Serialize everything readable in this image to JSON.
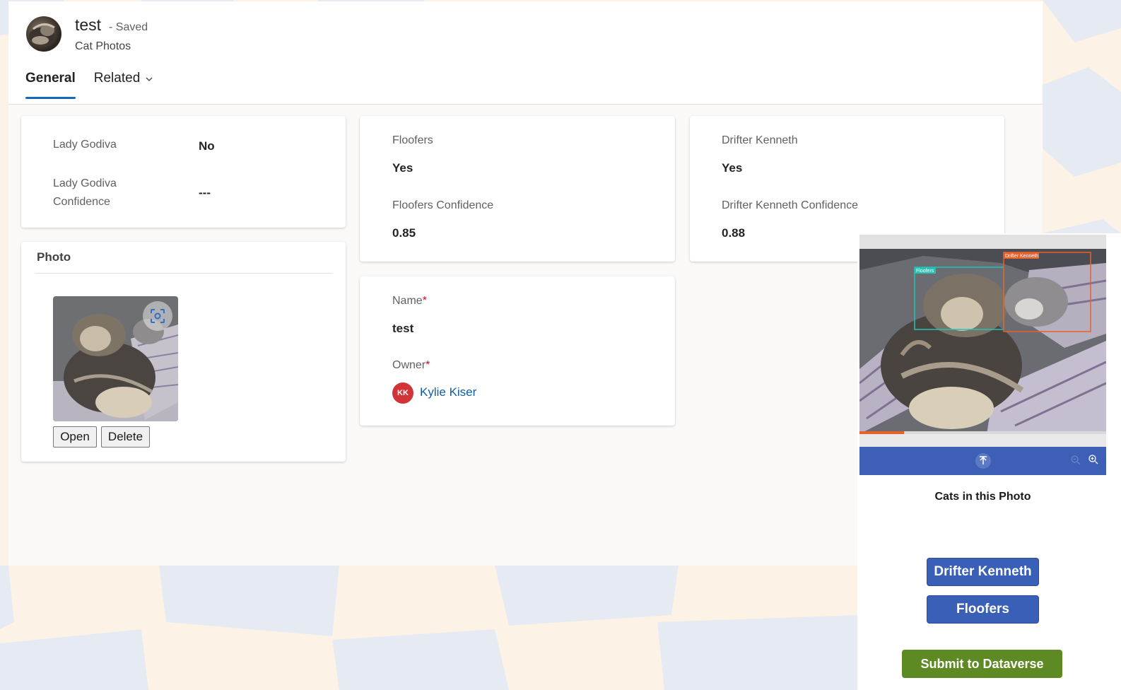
{
  "header": {
    "title": "test",
    "status": "- Saved",
    "entity": "Cat Photos",
    "avatar_icon": "cat-photo-avatar"
  },
  "tabs": [
    {
      "label": "General",
      "active": true
    },
    {
      "label": "Related",
      "active": false,
      "icon": "chevron-down-icon"
    }
  ],
  "cards": {
    "lady_godiva": {
      "label": "Lady Godiva",
      "value": "No",
      "confidence_label_line1": "Lady Godiva",
      "confidence_label_line2": "Confidence",
      "confidence_value": "---"
    },
    "floofers": {
      "label": "Floofers",
      "value": "Yes",
      "confidence_label": "Floofers Confidence",
      "confidence_value": "0.85"
    },
    "drifter_kenneth": {
      "label": "Drifter Kenneth",
      "value": "Yes",
      "confidence_label": "Drifter Kenneth Confidence",
      "confidence_value": "0.88"
    },
    "photo": {
      "title": "Photo",
      "open_label": "Open",
      "delete_label": "Delete",
      "scan_icon": "image-scan-icon"
    },
    "details": {
      "name_label": "Name",
      "name_value": "test",
      "owner_label": "Owner",
      "required_marker": "*",
      "owner_initials": "KK",
      "owner_name": "Kylie Kiser"
    }
  },
  "side_panel": {
    "detections": [
      {
        "label": "Floofers",
        "color": "#20c5b5"
      },
      {
        "label": "Drifter Kenneth",
        "color": "#e8602a"
      }
    ],
    "progress": 0.18,
    "toolbar_icons": [
      "upload-icon",
      "zoom-out-icon",
      "zoom-in-icon"
    ],
    "cats_title": "Cats in this Photo",
    "cat_buttons": [
      "Drifter Kenneth",
      "Floofers"
    ],
    "submit_label": "Submit to Dataverse"
  },
  "colors": {
    "accent_tab": "#0f6cbd",
    "cat_button": "#3a5fb6",
    "submit_button": "#5d8a23",
    "owner_chip": "#d13438",
    "bg_blue": "#e6ebf3",
    "bg_cream": "#fcf3e6"
  }
}
